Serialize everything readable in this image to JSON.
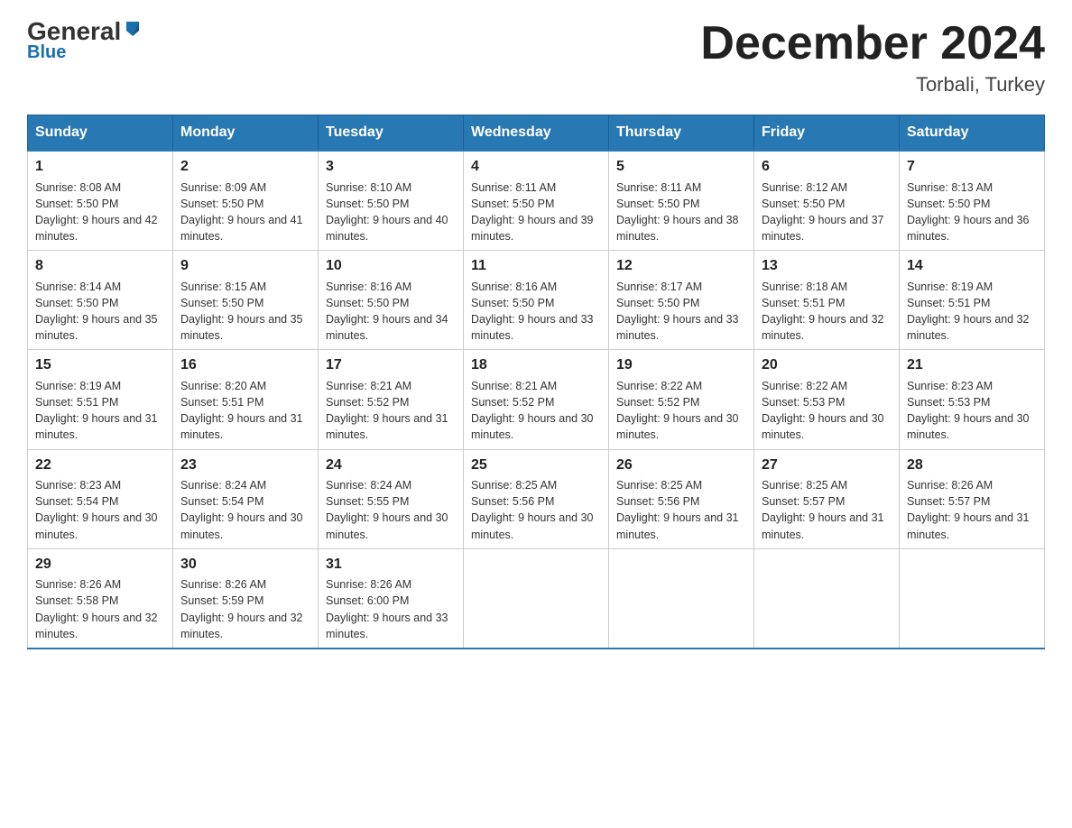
{
  "header": {
    "logo_general": "General",
    "logo_blue": "Blue",
    "month_title": "December 2024",
    "subtitle": "Torbali, Turkey"
  },
  "weekdays": [
    "Sunday",
    "Monday",
    "Tuesday",
    "Wednesday",
    "Thursday",
    "Friday",
    "Saturday"
  ],
  "weeks": [
    [
      {
        "day": "1",
        "sunrise": "8:08 AM",
        "sunset": "5:50 PM",
        "daylight": "9 hours and 42 minutes."
      },
      {
        "day": "2",
        "sunrise": "8:09 AM",
        "sunset": "5:50 PM",
        "daylight": "9 hours and 41 minutes."
      },
      {
        "day": "3",
        "sunrise": "8:10 AM",
        "sunset": "5:50 PM",
        "daylight": "9 hours and 40 minutes."
      },
      {
        "day": "4",
        "sunrise": "8:11 AM",
        "sunset": "5:50 PM",
        "daylight": "9 hours and 39 minutes."
      },
      {
        "day": "5",
        "sunrise": "8:11 AM",
        "sunset": "5:50 PM",
        "daylight": "9 hours and 38 minutes."
      },
      {
        "day": "6",
        "sunrise": "8:12 AM",
        "sunset": "5:50 PM",
        "daylight": "9 hours and 37 minutes."
      },
      {
        "day": "7",
        "sunrise": "8:13 AM",
        "sunset": "5:50 PM",
        "daylight": "9 hours and 36 minutes."
      }
    ],
    [
      {
        "day": "8",
        "sunrise": "8:14 AM",
        "sunset": "5:50 PM",
        "daylight": "9 hours and 35 minutes."
      },
      {
        "day": "9",
        "sunrise": "8:15 AM",
        "sunset": "5:50 PM",
        "daylight": "9 hours and 35 minutes."
      },
      {
        "day": "10",
        "sunrise": "8:16 AM",
        "sunset": "5:50 PM",
        "daylight": "9 hours and 34 minutes."
      },
      {
        "day": "11",
        "sunrise": "8:16 AM",
        "sunset": "5:50 PM",
        "daylight": "9 hours and 33 minutes."
      },
      {
        "day": "12",
        "sunrise": "8:17 AM",
        "sunset": "5:50 PM",
        "daylight": "9 hours and 33 minutes."
      },
      {
        "day": "13",
        "sunrise": "8:18 AM",
        "sunset": "5:51 PM",
        "daylight": "9 hours and 32 minutes."
      },
      {
        "day": "14",
        "sunrise": "8:19 AM",
        "sunset": "5:51 PM",
        "daylight": "9 hours and 32 minutes."
      }
    ],
    [
      {
        "day": "15",
        "sunrise": "8:19 AM",
        "sunset": "5:51 PM",
        "daylight": "9 hours and 31 minutes."
      },
      {
        "day": "16",
        "sunrise": "8:20 AM",
        "sunset": "5:51 PM",
        "daylight": "9 hours and 31 minutes."
      },
      {
        "day": "17",
        "sunrise": "8:21 AM",
        "sunset": "5:52 PM",
        "daylight": "9 hours and 31 minutes."
      },
      {
        "day": "18",
        "sunrise": "8:21 AM",
        "sunset": "5:52 PM",
        "daylight": "9 hours and 30 minutes."
      },
      {
        "day": "19",
        "sunrise": "8:22 AM",
        "sunset": "5:52 PM",
        "daylight": "9 hours and 30 minutes."
      },
      {
        "day": "20",
        "sunrise": "8:22 AM",
        "sunset": "5:53 PM",
        "daylight": "9 hours and 30 minutes."
      },
      {
        "day": "21",
        "sunrise": "8:23 AM",
        "sunset": "5:53 PM",
        "daylight": "9 hours and 30 minutes."
      }
    ],
    [
      {
        "day": "22",
        "sunrise": "8:23 AM",
        "sunset": "5:54 PM",
        "daylight": "9 hours and 30 minutes."
      },
      {
        "day": "23",
        "sunrise": "8:24 AM",
        "sunset": "5:54 PM",
        "daylight": "9 hours and 30 minutes."
      },
      {
        "day": "24",
        "sunrise": "8:24 AM",
        "sunset": "5:55 PM",
        "daylight": "9 hours and 30 minutes."
      },
      {
        "day": "25",
        "sunrise": "8:25 AM",
        "sunset": "5:56 PM",
        "daylight": "9 hours and 30 minutes."
      },
      {
        "day": "26",
        "sunrise": "8:25 AM",
        "sunset": "5:56 PM",
        "daylight": "9 hours and 31 minutes."
      },
      {
        "day": "27",
        "sunrise": "8:25 AM",
        "sunset": "5:57 PM",
        "daylight": "9 hours and 31 minutes."
      },
      {
        "day": "28",
        "sunrise": "8:26 AM",
        "sunset": "5:57 PM",
        "daylight": "9 hours and 31 minutes."
      }
    ],
    [
      {
        "day": "29",
        "sunrise": "8:26 AM",
        "sunset": "5:58 PM",
        "daylight": "9 hours and 32 minutes."
      },
      {
        "day": "30",
        "sunrise": "8:26 AM",
        "sunset": "5:59 PM",
        "daylight": "9 hours and 32 minutes."
      },
      {
        "day": "31",
        "sunrise": "8:26 AM",
        "sunset": "6:00 PM",
        "daylight": "9 hours and 33 minutes."
      },
      null,
      null,
      null,
      null
    ]
  ]
}
